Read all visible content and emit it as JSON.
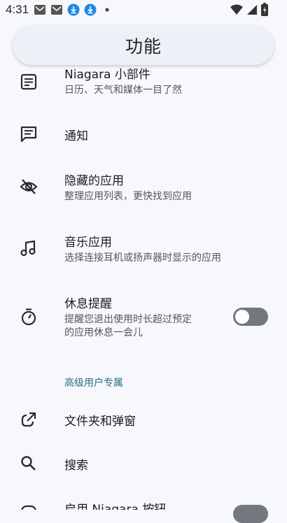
{
  "status": {
    "time": "4:31",
    "icons": [
      "mail-icon",
      "mail-icon",
      "download-icon",
      "download-icon",
      "dot-icon"
    ],
    "right_icons": [
      "wifi-icon",
      "signal-icon",
      "battery-icon"
    ]
  },
  "header": {
    "title": "功能"
  },
  "items": [
    {
      "title": "Niagara 小部件",
      "subtitle": "日历、天气和媒体一目了然",
      "icon": "widget-icon"
    },
    {
      "title": "通知",
      "icon": "message-icon"
    },
    {
      "title": "隐藏的应用",
      "subtitle": "整理应用列表，更快找到应用",
      "icon": "eye-off-icon"
    },
    {
      "title": "音乐应用",
      "subtitle": "选择连接耳机或扬声器时显示的应用",
      "icon": "music-icon"
    },
    {
      "title": "休息提醒",
      "subtitle_line1": "提醒您退出使用时长超过预定",
      "subtitle_line2": "的应用休息一会儿",
      "icon": "timer-icon",
      "toggle": "off"
    }
  ],
  "section": {
    "label": "高级用户专属"
  },
  "advanced_items": [
    {
      "title": "文件夹和弹窗",
      "icon": "open-external-icon"
    },
    {
      "title": "搜索",
      "icon": "search-icon"
    },
    {
      "title": "启用 Niagara 按钮",
      "icon": "button-icon"
    }
  ]
}
